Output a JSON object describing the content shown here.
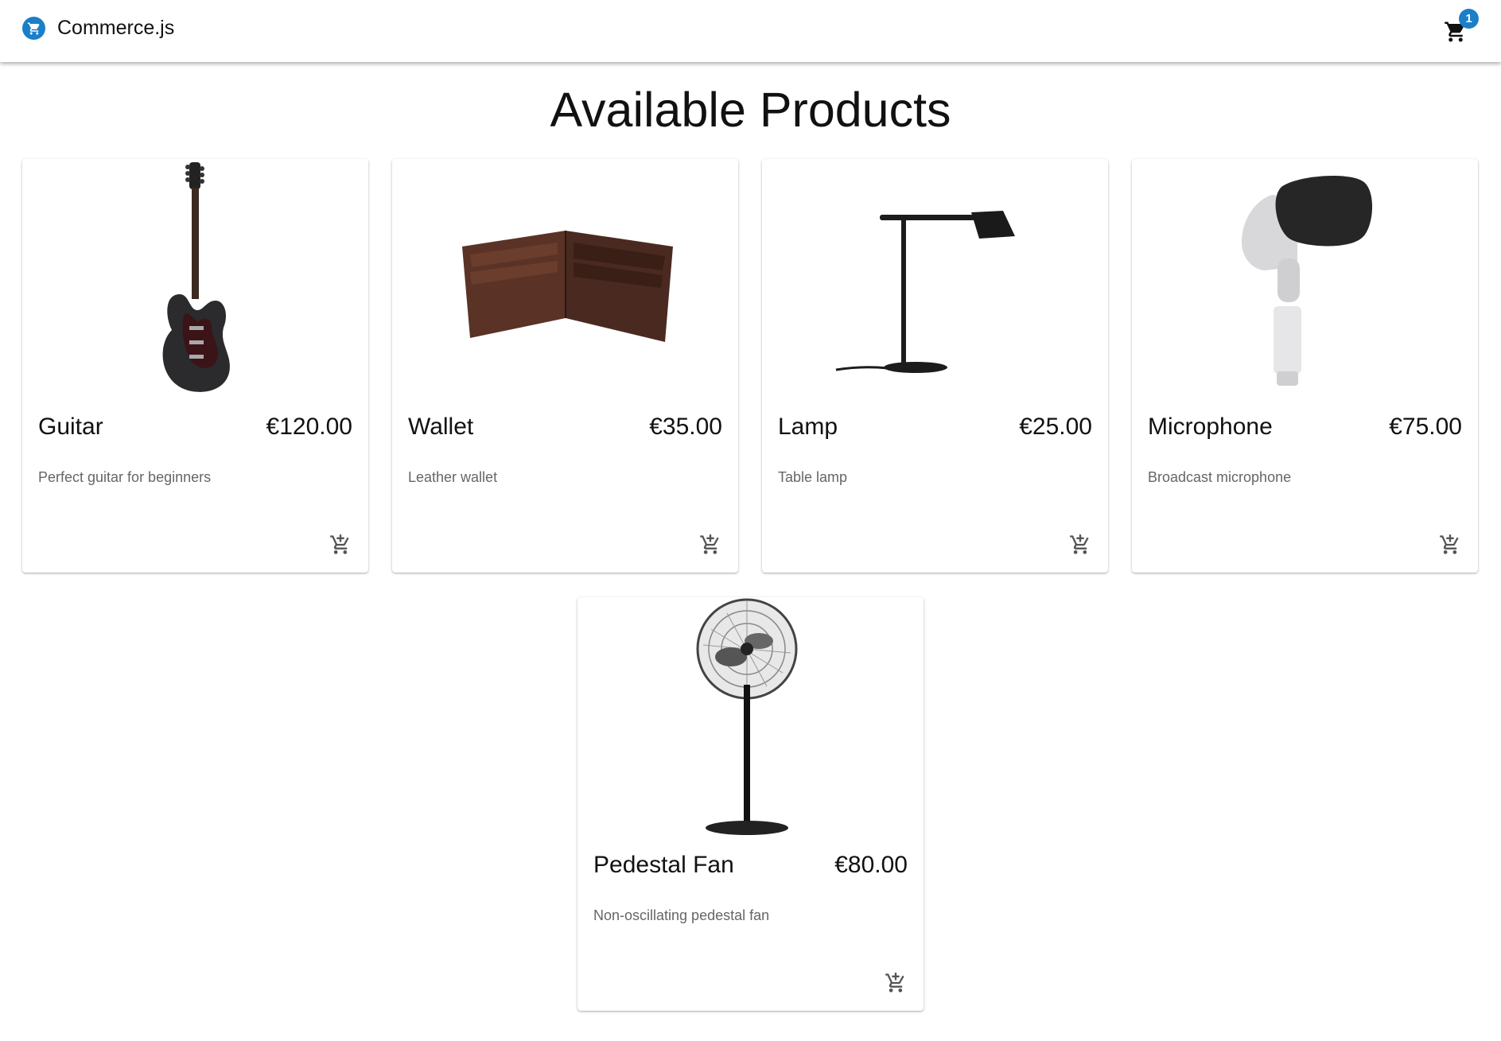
{
  "appbar": {
    "title": "Commerce.js",
    "cart_count": "1"
  },
  "main": {
    "title": "Available Products"
  },
  "products": [
    {
      "name": "Guitar",
      "price": "€120.00",
      "description": "Perfect guitar for beginners"
    },
    {
      "name": "Wallet",
      "price": "€35.00",
      "description": "Leather wallet"
    },
    {
      "name": "Lamp",
      "price": "€25.00",
      "description": "Table lamp"
    },
    {
      "name": "Microphone",
      "price": "€75.00",
      "description": "Broadcast microphone"
    },
    {
      "name": "Pedestal Fan",
      "price": "€80.00",
      "description": "Non-oscillating pedestal fan"
    }
  ],
  "icons": {
    "brand": "shopping-cart-logo-icon",
    "cart": "shopping-cart-icon",
    "add_to_cart": "add-shopping-cart-icon"
  },
  "colors": {
    "accent": "#1a7fc8",
    "text_secondary": "#666666"
  }
}
